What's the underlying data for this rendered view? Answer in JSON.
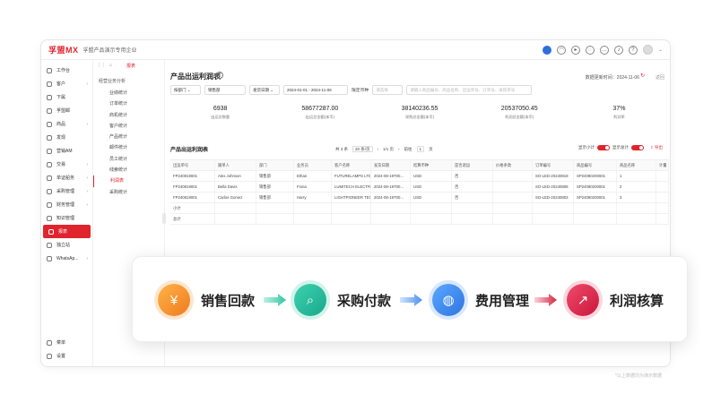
{
  "header": {
    "logo": "孚盟MX",
    "company": "孚盟产品演示专用企业"
  },
  "sidebar": {
    "items": [
      {
        "label": "工作台",
        "arrow": ""
      },
      {
        "label": "客户",
        "arrow": "›"
      },
      {
        "label": "下属",
        "arrow": ""
      },
      {
        "label": "孚盟邮",
        "arrow": ""
      },
      {
        "label": "商品",
        "arrow": "›"
      },
      {
        "label": "发现",
        "arrow": ""
      },
      {
        "label": "营销AM",
        "arrow": ""
      },
      {
        "label": "交易",
        "arrow": "›"
      },
      {
        "label": "单证船务",
        "arrow": "›"
      },
      {
        "label": "采购管理",
        "arrow": "›"
      },
      {
        "label": "财务管理",
        "arrow": "›"
      },
      {
        "label": "知识管理",
        "arrow": ""
      },
      {
        "label": "报表",
        "arrow": ""
      },
      {
        "label": "独立站",
        "arrow": ""
      },
      {
        "label": "WhatsAp...",
        "arrow": "›"
      }
    ],
    "bottom": [
      {
        "label": "菜单"
      },
      {
        "label": "设置"
      }
    ]
  },
  "submenu": {
    "tab_label": "报表",
    "title": "经营业务分析",
    "items": [
      "业绩统计",
      "订单统计",
      "商机统计",
      "客户统计",
      "产品统计",
      "邮件统计",
      "员工统计",
      "线索统计",
      "利润表",
      "采购统计"
    ],
    "active_index": 8
  },
  "main": {
    "title": "产品出运利润表",
    "update_label": "数据更新时间：2024-11-06",
    "back_label": "返回",
    "filters": {
      "dept": "按部门",
      "dept_value": "销售部",
      "date_type": "发货日期",
      "date_range": "2024-01-01 - 2024-11-06",
      "currency_label": "限定币种",
      "currency_placeholder": "请选择",
      "search_placeholder": "请输入商品编号、商品名称、出运单号、订单号、采购单号"
    },
    "stats": [
      {
        "value": "6938",
        "label": "出运总数量"
      },
      {
        "value": "58677287.00",
        "label": "出运总金额(本币)"
      },
      {
        "value": "38140236.55",
        "label": "采购总金额(本币)"
      },
      {
        "value": "20537050.45",
        "label": "利润总金额(本币)"
      },
      {
        "value": "37%",
        "label": "利润率"
      }
    ],
    "table_title": "产品出运利润表",
    "pager": {
      "total": "共 3 条",
      "per_page": "20 条/页",
      "page_info": "1/1 页",
      "goto": "前往",
      "page": "1",
      "page_suffix": "页"
    },
    "toggles": {
      "subtotal": "显示小计",
      "total": "显示总计",
      "export": "导出"
    },
    "columns": [
      "出运单号",
      "跟单人",
      "部门",
      "业务员",
      "客户名称",
      "发货日期",
      "结算币种",
      "是否退运",
      "价格条款",
      "订单编号",
      "商品编号",
      "商品名称",
      "计量"
    ],
    "rows": [
      [
        "FP240819001",
        "Alex Johnson",
        "销售部",
        "Ethan",
        "FUTURELAMPS LTD",
        "2024-08-19T00...",
        "USD",
        "否",
        "",
        "SO-LED-20240819",
        "SP24080200001",
        "1",
        ""
      ],
      [
        "FP240819001",
        "Bella Davis",
        "销售部",
        "Fiona",
        "LUMITECH ELECTR...",
        "2024-08-19T00...",
        "USD",
        "否",
        "",
        "SO-LED-20240808",
        "SP24080200001",
        "2",
        ""
      ],
      [
        "FP240819001",
        "Carlos Gomez",
        "销售部",
        "Harry",
        "LIGHTPIONEER TECH",
        "2024-08-19T00...",
        "USD",
        "否",
        "",
        "SO-LED-20240803",
        "SP24080200001",
        "3",
        ""
      ],
      [
        "小计",
        "",
        "",
        "",
        "",
        "",
        "",
        "",
        "",
        "",
        "",
        "",
        ""
      ],
      [
        "总计",
        "",
        "",
        "",
        "",
        "",
        "",
        "",
        "",
        "",
        "",
        "",
        ""
      ]
    ]
  },
  "flow": {
    "steps": [
      {
        "label": "销售回款",
        "icon": "¥"
      },
      {
        "label": "采购付款",
        "icon": "⌕"
      },
      {
        "label": "费用管理",
        "icon": "◍"
      },
      {
        "label": "利润核算",
        "icon": "↗"
      }
    ]
  },
  "footnote": "*以上数据均为演示数据"
}
